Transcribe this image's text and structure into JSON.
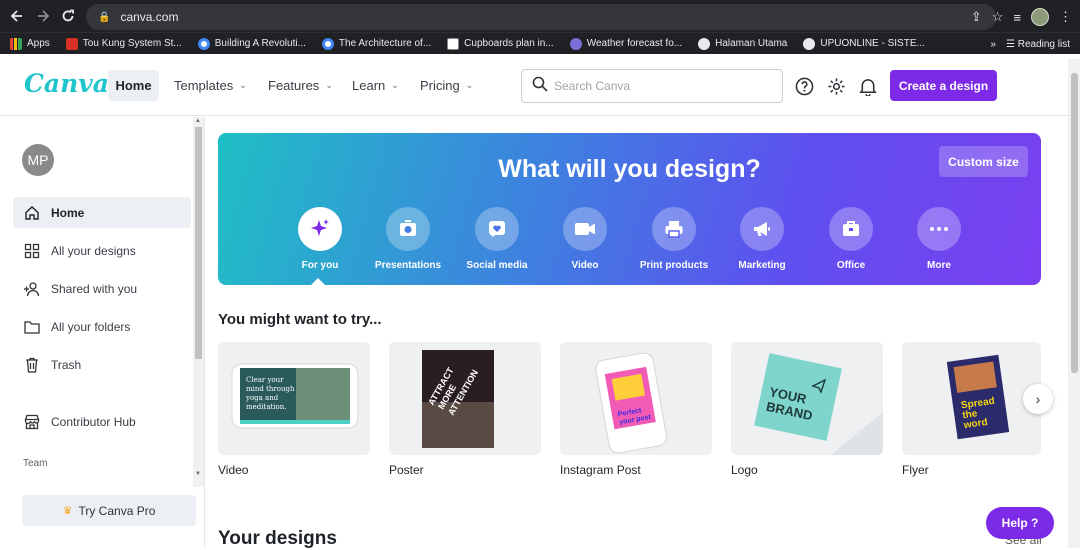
{
  "browser": {
    "url": "canva.com",
    "bookmarks": [
      {
        "label": "Apps",
        "color": "#f4b400"
      },
      {
        "label": "Tou Kung System St...",
        "color": "#d93025"
      },
      {
        "label": "Building A Revoluti...",
        "color": "#4285f4"
      },
      {
        "label": "The Architecture of...",
        "color": "#4285f4"
      },
      {
        "label": "Cupboards plan in...",
        "color": "#ffffff"
      },
      {
        "label": "Weather forecast fo...",
        "color": "#7c6fd6"
      },
      {
        "label": "Halaman Utama",
        "color": "#e8eaed"
      },
      {
        "label": "UPUONLINE - SISTE...",
        "color": "#e8eaed"
      }
    ],
    "reading_list": "Reading list",
    "more_bookmarks": "»"
  },
  "header": {
    "logo": "Canva",
    "nav": [
      {
        "label": "Home",
        "has_dropdown": false
      },
      {
        "label": "Templates",
        "has_dropdown": true
      },
      {
        "label": "Features",
        "has_dropdown": true
      },
      {
        "label": "Learn",
        "has_dropdown": true
      },
      {
        "label": "Pricing",
        "has_dropdown": true
      }
    ],
    "search_placeholder": "Search Canva",
    "create_label": "Create a design",
    "accent_color": "#7d2ae8"
  },
  "sidebar": {
    "avatar_initials": "MP",
    "items": [
      {
        "label": "Home",
        "icon": "home-icon"
      },
      {
        "label": "All your designs",
        "icon": "grid-icon"
      },
      {
        "label": "Shared with you",
        "icon": "shared-users-icon"
      },
      {
        "label": "All your folders",
        "icon": "folder-icon"
      },
      {
        "label": "Trash",
        "icon": "trash-icon"
      },
      {
        "label": "Contributor Hub",
        "icon": "store-icon"
      }
    ],
    "team_label": "Team",
    "try_pro_label": "Try Canva Pro"
  },
  "hero": {
    "title": "What will you design?",
    "custom_size": "Custom size",
    "categories": [
      {
        "label": "For you",
        "icon": "sparkle-icon"
      },
      {
        "label": "Presentations",
        "icon": "presentation-icon"
      },
      {
        "label": "Social media",
        "icon": "heart-icon"
      },
      {
        "label": "Video",
        "icon": "video-icon"
      },
      {
        "label": "Print products",
        "icon": "printer-icon"
      },
      {
        "label": "Marketing",
        "icon": "megaphone-icon"
      },
      {
        "label": "Office",
        "icon": "briefcase-icon"
      },
      {
        "label": "More",
        "icon": "more-icon"
      }
    ]
  },
  "suggestions": {
    "title": "You might want to try...",
    "items": [
      {
        "label": "Video",
        "thumb_text": "Clear your mind through yoga and meditation."
      },
      {
        "label": "Poster",
        "thumb_text": "ATTRACT MORE ATTENTION"
      },
      {
        "label": "Instagram Post",
        "thumb_text": "Perfect your post"
      },
      {
        "label": "Logo",
        "thumb_text": "YOUR BRAND"
      },
      {
        "label": "Flyer",
        "thumb_text": "Spread the word"
      }
    ]
  },
  "your_designs": {
    "title": "Your designs",
    "see_all": "See all"
  },
  "help_label": "Help  ?"
}
